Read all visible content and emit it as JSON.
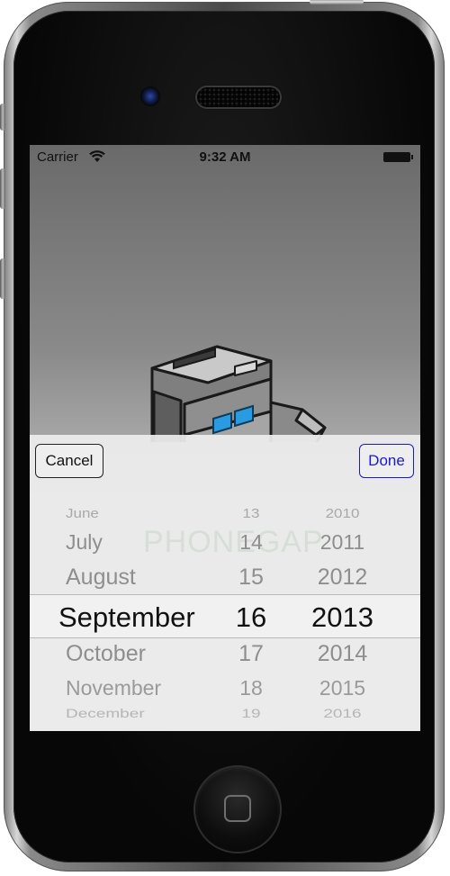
{
  "status_bar": {
    "carrier": "Carrier",
    "time": "9:32 AM"
  },
  "picker": {
    "cancel_label": "Cancel",
    "done_label": "Done",
    "months": [
      "June",
      "July",
      "August",
      "September",
      "October",
      "November",
      "December"
    ],
    "days": [
      "13",
      "14",
      "15",
      "16",
      "17",
      "18",
      "19"
    ],
    "years": [
      "2010",
      "2011",
      "2012",
      "2013",
      "2014",
      "2015",
      "2016"
    ],
    "selected": {
      "month": "September",
      "day": "16",
      "year": "2013"
    }
  },
  "colors": {
    "done_accent": "#1a1acc",
    "robot_screen": "#2a9be0"
  }
}
